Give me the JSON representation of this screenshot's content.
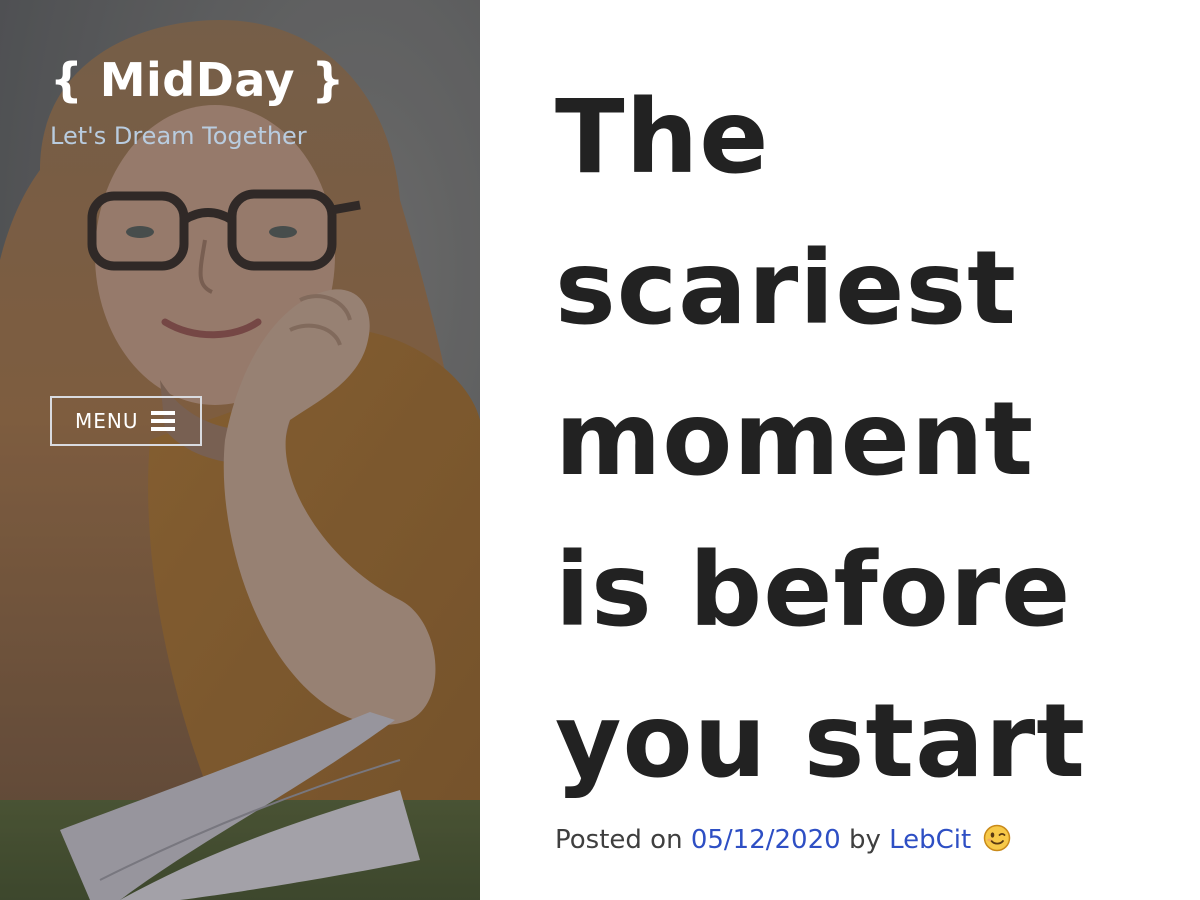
{
  "site": {
    "title": "{ MidDay }",
    "tagline": "Let's Dream Together"
  },
  "nav": {
    "menu_label": "MENU",
    "menu_icon": "hamburger-icon"
  },
  "header_image": {
    "subject": "woman-with-glasses-reading-book-on-grass"
  },
  "post": {
    "title": "The scariest moment is before you start",
    "meta": {
      "posted_on_label": "Posted on",
      "date": "05/12/2020",
      "by_label": "by",
      "author": "LebCit",
      "emoji_icon": "winking-face-emoji"
    }
  },
  "colors": {
    "sidebar_overlay": "#5a5b5e",
    "tagline": "#b9ccdf",
    "title_text": "#222222",
    "link": "#2e4fc4",
    "meta_text": "#3f3f3f"
  }
}
